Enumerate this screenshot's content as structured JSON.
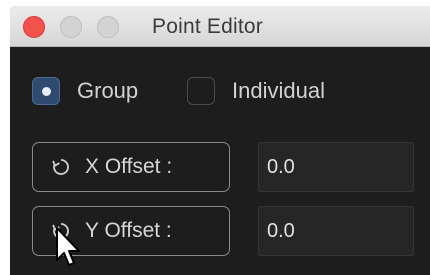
{
  "window": {
    "title": "Point Editor"
  },
  "mode": {
    "options": [
      {
        "label": "Group",
        "selected": true
      },
      {
        "label": "Individual",
        "selected": false
      }
    ]
  },
  "offsets": [
    {
      "button_label": "X Offset :",
      "value": "0.0",
      "icon": "reset-arrow-icon"
    },
    {
      "button_label": "Y Offset :",
      "value": "0.0",
      "icon": "reset-arrow-icon"
    }
  ],
  "colors": {
    "background": "#1d1d1e",
    "selected_radio": "#2f4a6e",
    "close_button": "#f2524c"
  }
}
